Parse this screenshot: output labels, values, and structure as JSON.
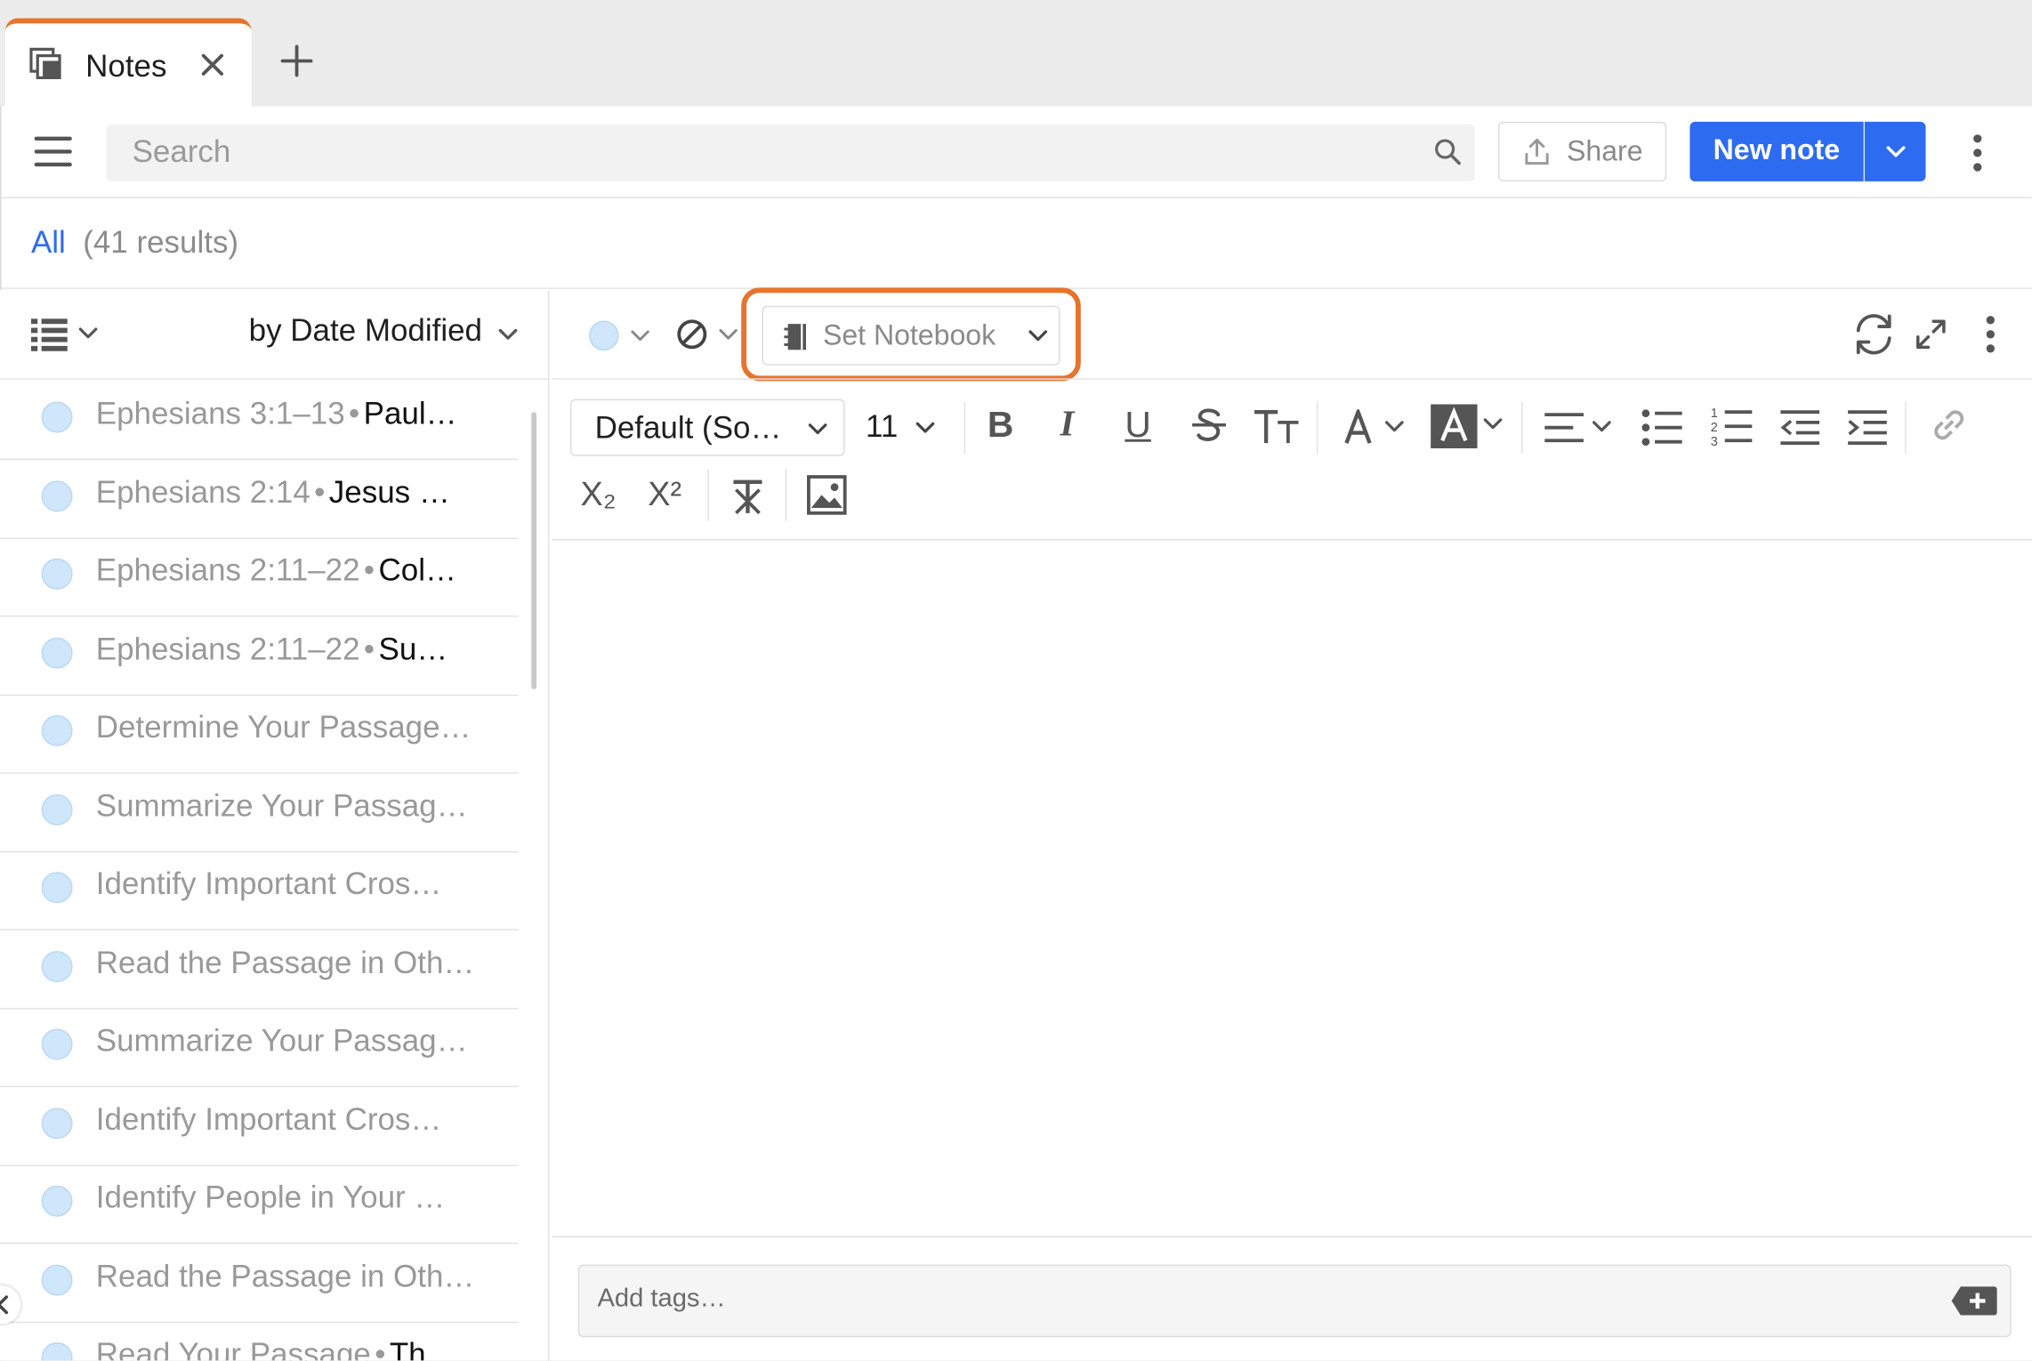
{
  "tab": {
    "title": "Notes",
    "close_icon": "close-icon",
    "add_icon": "plus-icon"
  },
  "toolbar": {
    "search_placeholder": "Search",
    "share_label": "Share",
    "new_note_label": "New note"
  },
  "filter": {
    "all_label": "All",
    "results_label": "(41 results)"
  },
  "list": {
    "sort_label": "by Date Modified",
    "items": [
      {
        "ref": "Ephesians 3:1–13",
        "title": "Paul…"
      },
      {
        "ref": "Ephesians 2:14",
        "title": "Jesus …"
      },
      {
        "ref": "Ephesians 2:11–22",
        "title": "Col…"
      },
      {
        "ref": "Ephesians 2:11–22",
        "title": "Su…"
      },
      {
        "ref": "",
        "title": "Determine Your Passage…"
      },
      {
        "ref": "",
        "title": "Summarize Your Passag…"
      },
      {
        "ref": "",
        "title": "Identify Important Cros…"
      },
      {
        "ref": "",
        "title": "Read the Passage in Oth…"
      },
      {
        "ref": "",
        "title": "Summarize Your Passag…"
      },
      {
        "ref": "",
        "title": "Identify Important Cros…"
      },
      {
        "ref": "",
        "title": "Identify People in Your …"
      },
      {
        "ref": "",
        "title": "Read the Passage in Oth…"
      },
      {
        "ref": "Read Your Passage",
        "title": "Th…"
      }
    ]
  },
  "editor": {
    "set_notebook_label": "Set Notebook",
    "font_label": "Default (So…",
    "font_size": "11",
    "tags_placeholder": "Add tags…",
    "format_buttons": {
      "bold": "B",
      "italic": "I",
      "underline": "U",
      "subscript": "X₂",
      "superscript": "X²"
    }
  },
  "colors": {
    "accent": "#2d6cf0",
    "highlight": "#e8732c",
    "note_dot": "#cfe6fb"
  }
}
